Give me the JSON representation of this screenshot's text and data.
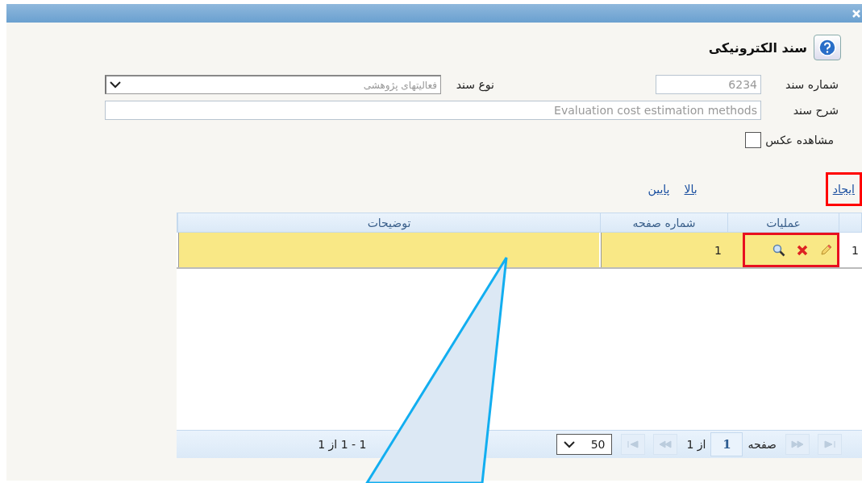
{
  "header": {
    "title": "سند الکترونیکی"
  },
  "form": {
    "doc_number": {
      "label": "شماره سند",
      "value": "6234"
    },
    "doc_type": {
      "label": "نوع سند",
      "value": "فعالیتهای پژوهشی"
    },
    "description": {
      "label": "شرح سند",
      "value": "Evaluation cost estimation methods"
    },
    "show_image": {
      "label": "مشاهده عکس",
      "checked": false
    }
  },
  "links": [
    {
      "label": "ایجاد",
      "highlighted": true
    },
    {
      "label": "بالا",
      "highlighted": false
    },
    {
      "label": "پایین",
      "highlighted": false
    }
  ],
  "table": {
    "columns": [
      "عملیات",
      "شماره صفحه",
      "توضیحات"
    ],
    "rows": [
      {
        "row_number": "1",
        "selected": true,
        "actions_highlighted": true,
        "page_number": "1"
      }
    ]
  },
  "pager": {
    "page_label": "صفحه",
    "page": "1",
    "of_pages": "از 1",
    "page_size": "50",
    "summary": "1 - 1 از 1"
  }
}
